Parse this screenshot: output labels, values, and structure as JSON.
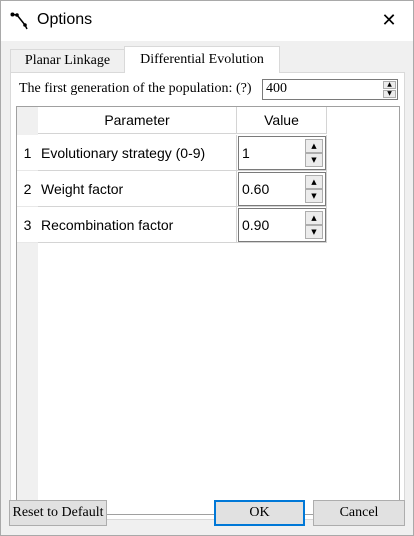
{
  "window": {
    "title": "Options",
    "icon": "linkage-icon",
    "close_glyph": "✕"
  },
  "tabs": [
    {
      "label": "Planar Linkage",
      "selected": false
    },
    {
      "label": "Differential Evolution",
      "selected": true
    }
  ],
  "population": {
    "label": "The first generation of the population: (?)",
    "value": "400"
  },
  "table": {
    "headers": {
      "parameter": "Parameter",
      "value": "Value"
    },
    "rows": [
      {
        "index": "1",
        "parameter": "Evolutionary strategy (0-9)",
        "value": "1"
      },
      {
        "index": "2",
        "parameter": "Weight factor",
        "value": "0.60"
      },
      {
        "index": "3",
        "parameter": "Recombination factor",
        "value": "0.90"
      }
    ]
  },
  "buttons": {
    "reset": "Reset to Default",
    "ok": "OK",
    "cancel": "Cancel"
  },
  "colors": {
    "accent": "#0078d7",
    "dialog_bg": "#f0f0f0"
  }
}
